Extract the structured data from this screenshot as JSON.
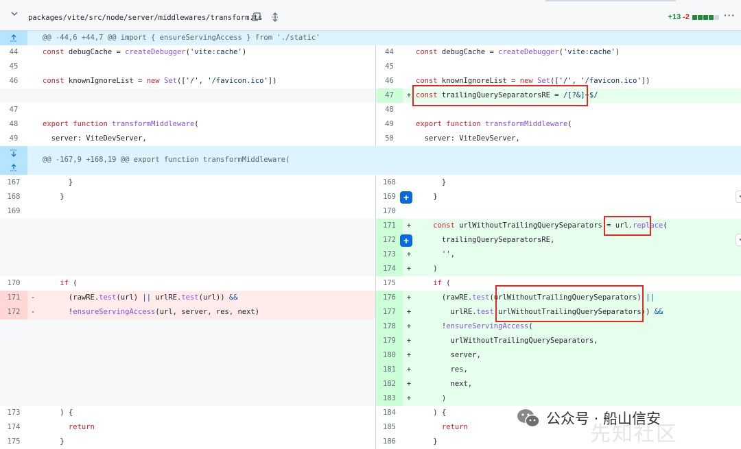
{
  "file": {
    "path": "packages/vite/src/node/server/middlewares/transform.ts",
    "additions": "+13",
    "deletions": "-2",
    "more_label": "···"
  },
  "hunks": [
    "@@ -44,6 +44,7 @@ import { ensureServingAccess } from './static'",
    "@@ -167,9 +168,19 @@ export function transformMiddleware("
  ],
  "left_numbers": [
    "44",
    "45",
    "46",
    "47",
    "48",
    "49",
    "167",
    "168",
    "169",
    "170",
    "171",
    "172",
    "173",
    "174",
    "175"
  ],
  "right_numbers": [
    "44",
    "45",
    "46",
    "47",
    "48",
    "49",
    "50",
    "168",
    "169",
    "170",
    "171",
    "172",
    "173",
    "174",
    "175",
    "176",
    "177",
    "178",
    "179",
    "180",
    "181",
    "182",
    "183",
    "184",
    "185",
    "186"
  ],
  "markers": {
    "add": "+",
    "del": "-"
  },
  "code": {
    "r46": "const knownIgnoreList = new Set(['/', '/favicon.ico'])",
    "r47": "const trailingQuerySeparatorsRE = /[?&]+$/",
    "export_fn": "export function transformMiddleware(",
    "server_param": "  server: ViteDevServer,",
    "close_brace_1": "      }",
    "close_brace_2": "    }",
    "r171": "    const urlWithoutTrailingQuerySeparators = url.replace(",
    "r172": "      trailingQuerySeparatorsRE,",
    "r173": "      '',",
    "r174": "    )",
    "if_open": "    if (",
    "l171": "      (rawRE.test(url) || urlRE.test(url)) &&",
    "l172": "      !ensureServingAccess(url, server, res, next)",
    "r176": "      (rawRE.test(urlWithoutTrailingQuerySeparators) ||",
    "r177": "        urlRE.test(urlWithoutTrailingQuerySeparators)) &&",
    "r178": "      !ensureServingAccess(",
    "r179": "        urlWithoutTrailingQuerySeparators,",
    "r180": "        server,",
    "r181": "        res,",
    "r182": "        next,",
    "r183": "      )",
    "close_if": "    ) {",
    "return_kw": "      return",
    "close_brace_3": "    }",
    "debug_cache": "const debugCache = createDebugger('vite:cache')"
  },
  "watermark": {
    "text": "公众号 · 船山信安",
    "ghost": "先知社区"
  },
  "colors": {
    "addition_bg": "#e6ffec",
    "deletion_bg": "#ffebe9",
    "hunk_bg": "#ddf4ff",
    "highlight_box": "#e5281f"
  }
}
